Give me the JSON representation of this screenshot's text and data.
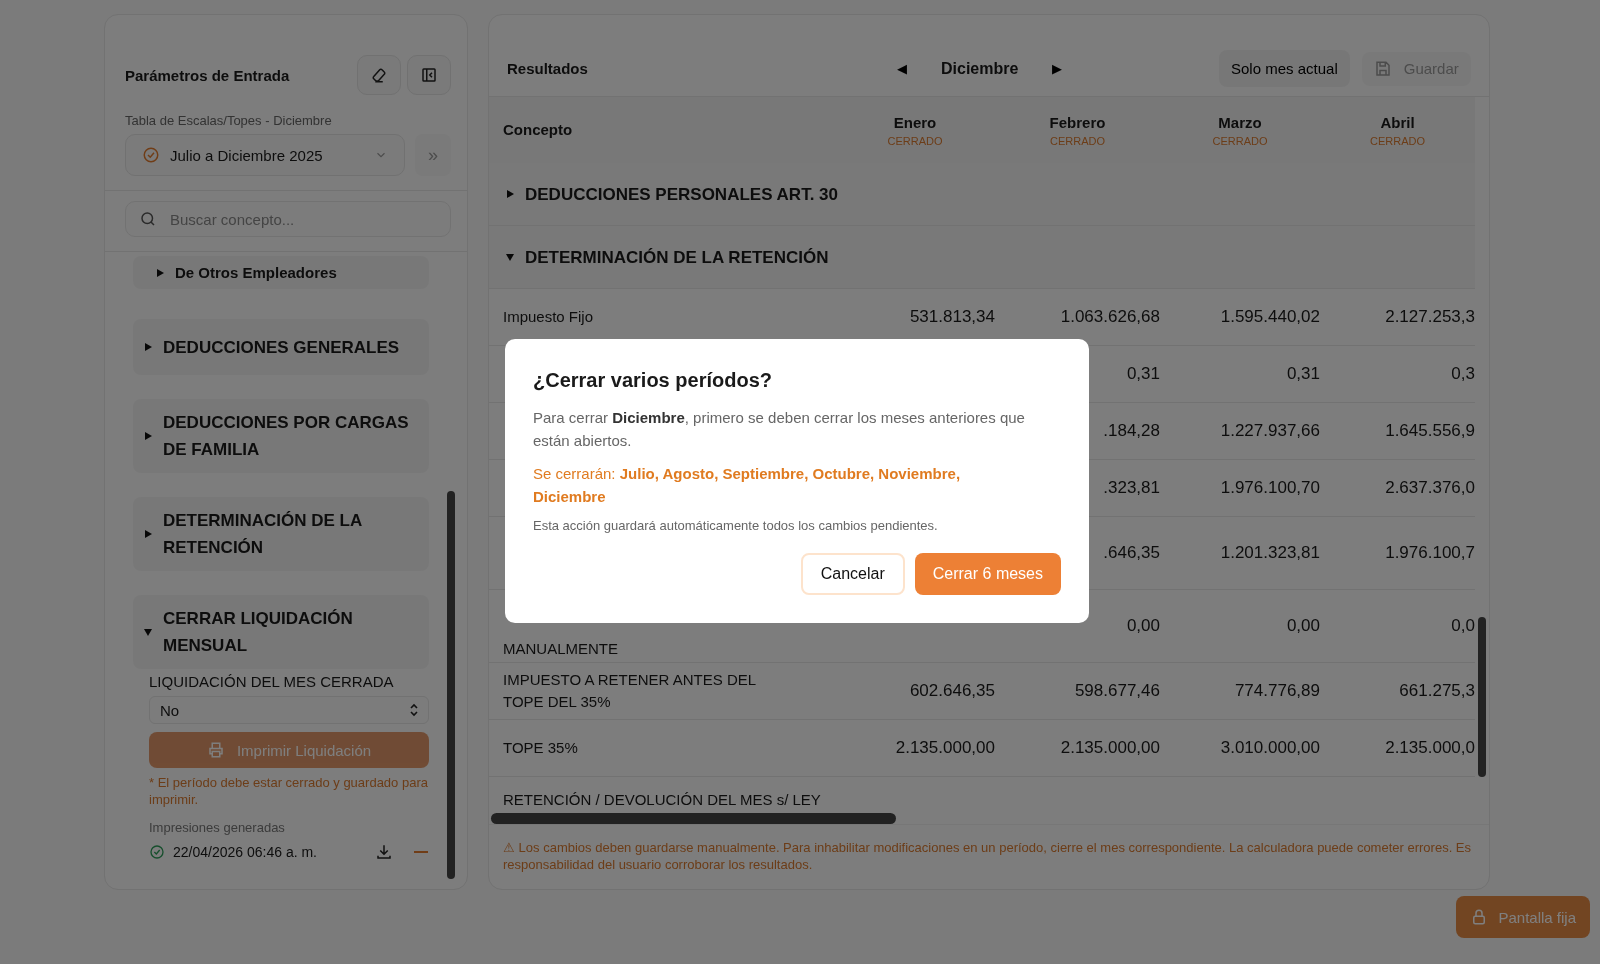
{
  "sidebar": {
    "title": "Parámetros de Entrada",
    "table_label": "Tabla de Escalas/Topes - Diciembre",
    "period_select": {
      "value": "Julio a Diciembre 2025"
    },
    "expand_button": "»",
    "search": {
      "placeholder": "Buscar concepto..."
    },
    "items": [
      {
        "kind": "subitem",
        "label": "De Otros Empleadores",
        "expanded": false
      },
      {
        "kind": "section",
        "label": "DEDUCCIONES GENERALES",
        "expanded": false
      },
      {
        "kind": "section",
        "label": "DEDUCCIONES POR CARGAS DE FAMILIA",
        "expanded": false
      },
      {
        "kind": "section",
        "label": "DETERMINACIÓN DE LA RETENCIÓN",
        "expanded": false
      },
      {
        "kind": "section",
        "label": "CERRAR LIQUIDACIÓN MENSUAL",
        "expanded": true
      }
    ],
    "closing": {
      "field_label": "LIQUIDACIÓN DEL MES CERRADA",
      "select_value": "No",
      "print_button": {
        "label": "Imprimir Liquidación",
        "disabled": true
      },
      "note": "* El período debe estar cerrado y guardado para imprimir.",
      "prints_label": "Impresiones generadas",
      "prints": [
        {
          "date": "22/04/2026 06:46 a. m."
        }
      ]
    }
  },
  "results": {
    "title": "Resultados",
    "prev": "◀",
    "month": "Diciembre",
    "next": "▶",
    "only_current": "Solo mes actual",
    "save": {
      "label": "Guardar",
      "disabled": true
    },
    "concept_header": "Concepto",
    "months": [
      {
        "name": "Enero",
        "status": "CERRADO"
      },
      {
        "name": "Febrero",
        "status": "CERRADO"
      },
      {
        "name": "Marzo",
        "status": "CERRADO"
      },
      {
        "name": "Abril",
        "status": "CERRADO"
      }
    ],
    "rows": [
      {
        "kind": "group",
        "concept": "DEDUCCIONES PERSONALES ART. 30",
        "expanded": false
      },
      {
        "kind": "group",
        "concept": "DETERMINACIÓN DE LA RETENCIÓN",
        "expanded": true
      },
      {
        "kind": "data",
        "concept": "Impuesto Fijo",
        "values": [
          "531.813,34",
          "1.063.626,68",
          "1.595.440,02",
          "2.127.253,3"
        ]
      },
      {
        "kind": "data",
        "values": [
          "0,31",
          "0,31",
          "0,3"
        ]
      },
      {
        "kind": "data",
        "values": [
          ".184,28",
          "1.227.937,66",
          "1.645.556,9"
        ]
      },
      {
        "kind": "data",
        "values": [
          ".323,81",
          "1.976.100,70",
          "2.637.376,0"
        ]
      },
      {
        "kind": "data",
        "values": [
          ".646,35",
          "1.201.323,81",
          "1.976.100,7"
        ]
      },
      {
        "kind": "data",
        "concept": "MANUALMENTE",
        "values": [
          "0,00",
          "0,00",
          "0,0"
        ]
      },
      {
        "kind": "data",
        "concept": "IMPUESTO A RETENER ANTES DEL TOPE DEL 35%",
        "values": [
          "602.646,35",
          "598.677,46",
          "774.776,89",
          "661.275,3"
        ]
      },
      {
        "kind": "data",
        "concept": "TOPE 35%",
        "values": [
          "2.135.000,00",
          "2.135.000,00",
          "3.010.000,00",
          "2.135.000,0"
        ]
      },
      {
        "kind": "cut",
        "concept": "RETENCIÓN / DEVOLUCIÓN DEL MES s/ LEY"
      }
    ],
    "warning": "⚠ Los cambios deben guardarse manualmente. Para inhabilitar modificaciones en un período, cierre el mes correspondiente. La calculadora puede cometer errores. Es responsabilidad del usuario corroborar los resultados."
  },
  "pin_button": "Pantalla fija",
  "modal": {
    "title": "¿Cerrar varios períodos?",
    "body": "Para cerrar **Diciembre**, primero se deben cerrar los meses anteriores que están abiertos.",
    "closing": "Se cerrarán: **Julio, Agosto, Septiembre, Octubre, Noviembre, Diciembre**",
    "note": "Esta acción guardará automáticamente todos los cambios pendientes.",
    "buttons": [
      {
        "label": "Cancelar",
        "kind": "secondary"
      },
      {
        "label": "Cerrar 6 meses",
        "kind": "primary"
      }
    ]
  }
}
